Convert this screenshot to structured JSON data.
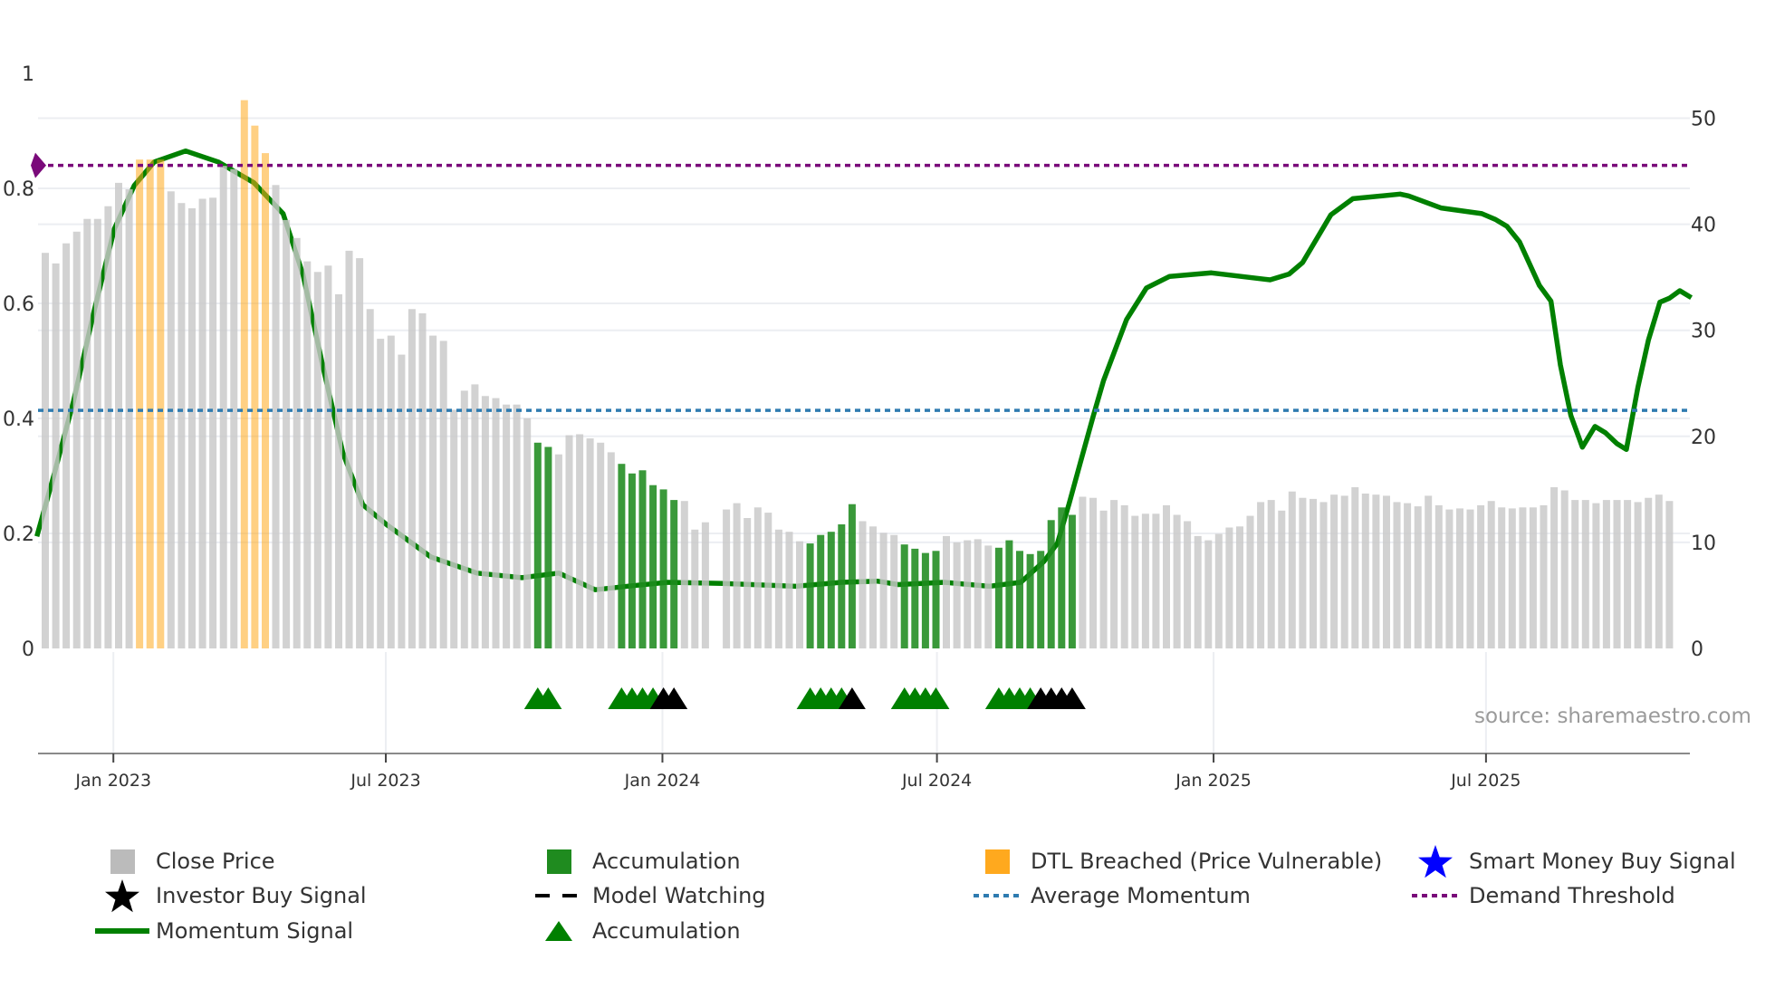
{
  "chart_data": {
    "type": "bar+line",
    "title": "",
    "source_text": "source: sharemaestro.com",
    "x_unit": "week index (weekly bars)",
    "x_range": [
      -0.7,
      157.2
    ],
    "x_ticks": [
      {
        "label": "Jan 2023",
        "index": 6.5
      },
      {
        "label": "Jul 2023",
        "index": 32.5
      },
      {
        "label": "Jan 2024",
        "index": 58.9
      },
      {
        "label": "Jul 2024",
        "index": 85.1
      },
      {
        "label": "Jan 2025",
        "index": 111.5
      },
      {
        "label": "Jul 2025",
        "index": 137.5
      }
    ],
    "left_axis": {
      "range": [
        0,
        1
      ],
      "ticks": [
        "0",
        "0.2",
        "0.4",
        "0.6",
        "0.8",
        "1"
      ],
      "tick_values": [
        0,
        0.2,
        0.4,
        0.6,
        0.8,
        1
      ]
    },
    "right_axis": {
      "range": [
        0,
        50
      ],
      "ticks": [
        "0",
        "10",
        "20",
        "30",
        "40",
        "50"
      ],
      "tick_values": [
        0,
        10,
        20,
        30,
        40,
        50
      ]
    },
    "grid": true,
    "close_price": [
      37.3,
      36.3,
      38.2,
      39.3,
      40.5,
      40.5,
      41.7,
      43.9,
      43.3,
      46.1,
      46.1,
      46.1,
      43.1,
      42.0,
      41.5,
      42.4,
      42.5,
      45.5,
      45.2,
      51.7,
      49.3,
      46.7,
      43.7,
      40.4,
      38.7,
      36.5,
      35.5,
      36.1,
      33.4,
      37.5,
      36.8,
      32.0,
      29.2,
      29.5,
      27.7,
      32.0,
      31.6,
      29.5,
      29.0,
      22.5,
      24.3,
      24.9,
      23.8,
      23.6,
      23.0,
      23.0,
      21.7,
      19.4,
      19.0,
      18.3,
      20.1,
      20.2,
      19.8,
      19.4,
      18.5,
      17.4,
      16.5,
      16.8,
      15.4,
      15.0,
      14.0,
      13.9,
      11.2,
      11.9,
      null,
      13.1,
      13.7,
      12.3,
      13.3,
      12.8,
      11.2,
      11.0,
      10.1,
      9.9,
      10.7,
      11.0,
      11.7,
      13.6,
      12.0,
      11.5,
      10.9,
      10.7,
      9.8,
      9.4,
      9.0,
      9.2,
      10.6,
      10.0,
      10.2,
      10.3,
      9.7,
      9.5,
      10.2,
      9.2,
      8.9,
      9.2,
      12.1,
      13.3,
      12.6,
      14.3,
      14.2,
      13.0,
      14.0,
      13.5,
      12.5,
      12.7,
      12.7,
      13.5,
      12.6,
      12.0,
      10.6,
      10.2,
      10.8,
      11.4,
      11.5,
      12.5,
      13.8,
      14.0,
      13.0,
      14.8,
      14.2,
      14.1,
      13.8,
      14.5,
      14.4,
      15.2,
      14.6,
      14.5,
      14.4,
      13.8,
      13.7,
      13.4,
      14.4,
      13.5,
      13.1,
      13.2,
      13.1,
      13.5,
      13.9,
      13.3,
      13.2,
      13.3,
      13.3,
      13.5,
      15.2,
      14.9,
      14.0,
      14.0,
      13.7,
      14.0,
      14.0,
      14.0,
      13.8,
      14.2,
      14.5,
      13.9
    ],
    "accumulation_bar_indices": [
      47,
      48,
      55,
      56,
      57,
      58,
      59,
      60,
      73,
      74,
      75,
      76,
      77,
      82,
      83,
      84,
      85,
      91,
      92,
      93,
      94,
      95,
      96,
      97,
      98
    ],
    "dtl_breached_bar_indices": [
      9,
      10,
      11,
      19,
      20,
      21
    ],
    "momentum_signal": {
      "x": [
        -0.8,
        0.8,
        2.7,
        4.7,
        6.6,
        8.5,
        10.4,
        13.4,
        16.5,
        19.9,
        22.7,
        24.6,
        26.5,
        28.4,
        30.3,
        32.6,
        36.8,
        41.2,
        45.5,
        49,
        52.5,
        56,
        59.4,
        64.7,
        71.6,
        76,
        79.4,
        81.4,
        85.8,
        90.1,
        93.1,
        95.3,
        96.6,
        97.7,
        98.8,
        100,
        101,
        103.2,
        105.1,
        107.3,
        111.3,
        116.9,
        118.7,
        120,
        122.7,
        124.8,
        129.3,
        130.1,
        133.2,
        137.1,
        138.4,
        139.5,
        140.7,
        142.6,
        143.7,
        144.6,
        145.6,
        146.7,
        147.9,
        148.9,
        150,
        150.9,
        152,
        153,
        154.1,
        155,
        156,
        157.1
      ],
      "y": [
        0.195,
        0.3,
        0.43,
        0.59,
        0.73,
        0.805,
        0.846,
        0.865,
        0.846,
        0.81,
        0.756,
        0.65,
        0.49,
        0.34,
        0.25,
        0.215,
        0.159,
        0.131,
        0.123,
        0.131,
        0.102,
        0.109,
        0.115,
        0.113,
        0.108,
        0.115,
        0.117,
        0.111,
        0.115,
        0.108,
        0.115,
        0.151,
        0.183,
        0.251,
        0.324,
        0.403,
        0.466,
        0.572,
        0.627,
        0.647,
        0.653,
        0.641,
        0.651,
        0.671,
        0.754,
        0.782,
        0.79,
        0.787,
        0.766,
        0.756,
        0.746,
        0.734,
        0.707,
        0.631,
        0.604,
        0.493,
        0.405,
        0.35,
        0.386,
        0.375,
        0.356,
        0.346,
        0.454,
        0.536,
        0.602,
        0.609,
        0.622,
        0.61
      ]
    },
    "average_momentum": 0.414,
    "demand_threshold": 0.84,
    "accumulation_markers": [
      47,
      48,
      55,
      56,
      57,
      58,
      73,
      74,
      75,
      76,
      82,
      83,
      84,
      85,
      91,
      92,
      93,
      94
    ],
    "model_watching_markers": [
      59,
      60,
      77,
      95,
      96,
      97,
      98
    ],
    "colors": {
      "close_price": "#c8c8c8",
      "accumulation": "#1f8b1f",
      "dtl": "#ffa91e",
      "momentum": "#008000",
      "average_momentum": "#2e7bb0",
      "demand_threshold": "#7a0a7a",
      "model_watching": "#000000",
      "smart_money": "#0000ff",
      "investor": "#000000"
    },
    "legend": {
      "placement": "bottom",
      "items": [
        {
          "label": "Close Price",
          "icon": "grey-square"
        },
        {
          "label": "Accumulation",
          "icon": "green-square"
        },
        {
          "label": "DTL Breached (Price Vulnerable)",
          "icon": "orange-square"
        },
        {
          "label": "Smart Money Buy Signal",
          "icon": "blue-star"
        },
        {
          "label": "Investor Buy Signal",
          "icon": "black-star"
        },
        {
          "label": "Model Watching",
          "icon": "black-dashed-line"
        },
        {
          "label": "Average Momentum",
          "icon": "blue-dotted-line"
        },
        {
          "label": "Demand Threshold",
          "icon": "purple-dotted-line"
        },
        {
          "label": "Momentum Signal",
          "icon": "green-line"
        },
        {
          "label": "Accumulation",
          "icon": "green-triangle"
        }
      ]
    }
  }
}
